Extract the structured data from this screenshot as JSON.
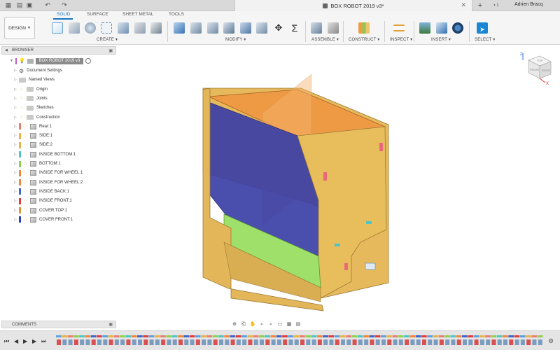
{
  "titlebar": {
    "doc_title": "BOX ROBOT 2019 v3*",
    "notifications": "1",
    "user": "Adrien Bracq"
  },
  "toolbar": {
    "workspace": "DESIGN",
    "tabs": [
      "SOLID",
      "SURFACE",
      "SHEET METAL",
      "TOOLS"
    ],
    "active_tab": "SOLID",
    "groups": [
      "CREATE",
      "MODIFY",
      "ASSEMBLE",
      "CONSTRUCT",
      "INSPECT",
      "INSERT",
      "SELECT"
    ]
  },
  "browser": {
    "title": "BROWSER",
    "root": "BOX ROBOT 2019 v3",
    "items": [
      {
        "label": "Document Settings",
        "kind": "gear",
        "color": ""
      },
      {
        "label": "Named Views",
        "kind": "folder",
        "color": ""
      },
      {
        "label": "Origin",
        "kind": "folder",
        "color": ""
      },
      {
        "label": "Joints",
        "kind": "folder",
        "color": ""
      },
      {
        "label": "Sketches",
        "kind": "folder",
        "color": ""
      },
      {
        "label": "Construction",
        "kind": "folder",
        "color": ""
      },
      {
        "label": "Rear:1",
        "kind": "body",
        "color": "#e77f73"
      },
      {
        "label": "SIDE:1",
        "kind": "body",
        "color": "#e8b34a"
      },
      {
        "label": "SIDE:2",
        "kind": "body",
        "color": "#e8b34a"
      },
      {
        "label": "INSIDE BOTTOM:1",
        "kind": "body",
        "color": "#4fc5c5"
      },
      {
        "label": "BOTTOM:1",
        "kind": "body",
        "color": "#8fd14f"
      },
      {
        "label": "INSIDE FOR WHEEL:1",
        "kind": "body",
        "color": "#f0873a"
      },
      {
        "label": "INSIDE FOR WHEEL:2",
        "kind": "body",
        "color": "#f0873a"
      },
      {
        "label": "INSIDE BACK:1",
        "kind": "body",
        "color": "#3d66c9"
      },
      {
        "label": "INSIDE FRONT:1",
        "kind": "body",
        "color": "#e23b3b"
      },
      {
        "label": "COVER TOP:1",
        "kind": "body",
        "color": "#e8913a"
      },
      {
        "label": "COVER FRONT:1",
        "kind": "body",
        "color": "#2e3fbf"
      }
    ]
  },
  "viewcube": {
    "top": "TOP",
    "front": "FRONT",
    "right": "RIGHT",
    "axis_x": "X",
    "axis_z": "Z"
  },
  "comments": {
    "title": "COMMENTS"
  },
  "timeline": {
    "feature_count": 84
  }
}
